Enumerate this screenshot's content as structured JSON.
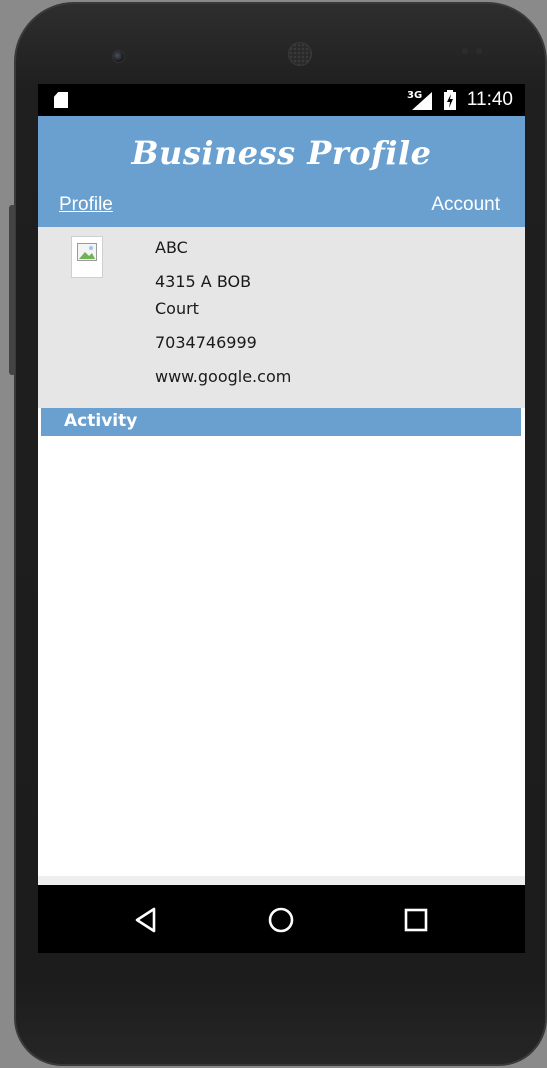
{
  "status_bar": {
    "network": "3G",
    "time": "11:40"
  },
  "header": {
    "title": "Business Profile",
    "tabs": {
      "profile": "Profile",
      "account": "Account"
    }
  },
  "profile": {
    "name": "ABC",
    "address_line1": "4315 A BOB",
    "address_line2": "Court",
    "phone": "7034746999",
    "website": "www.google.com"
  },
  "activity": {
    "label": "Activity"
  },
  "navigation": {
    "icons": [
      "back-icon",
      "home-icon",
      "recents-icon"
    ]
  },
  "colors": {
    "accent": "#6aa0d0",
    "panel": "#e6e6e6"
  }
}
